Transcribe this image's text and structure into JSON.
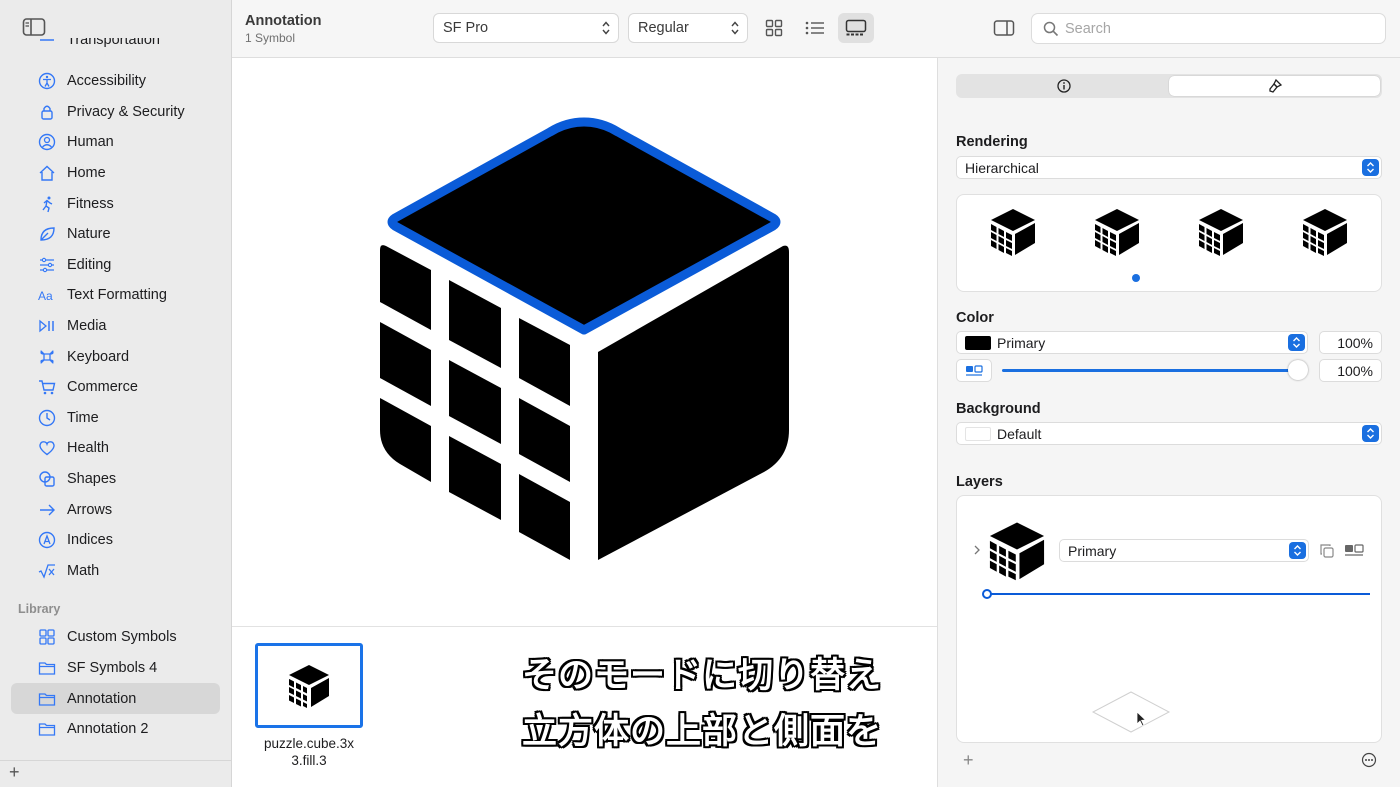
{
  "toolbar": {
    "title": "Annotation",
    "subtitle": "1 Symbol",
    "font_family_value": "SF Pro",
    "weight_value": "Regular",
    "search_placeholder": "Search"
  },
  "sidebar": {
    "partial_item": "Transportation",
    "categories": [
      {
        "label": "Accessibility",
        "icon": "accessibility-icon"
      },
      {
        "label": "Privacy & Security",
        "icon": "lock-icon"
      },
      {
        "label": "Human",
        "icon": "person-circle-icon"
      },
      {
        "label": "Home",
        "icon": "house-icon"
      },
      {
        "label": "Fitness",
        "icon": "figure-run-icon"
      },
      {
        "label": "Nature",
        "icon": "leaf-icon"
      },
      {
        "label": "Editing",
        "icon": "sliders-icon"
      },
      {
        "label": "Text Formatting",
        "icon": "textformat-icon"
      },
      {
        "label": "Media",
        "icon": "play-pause-icon"
      },
      {
        "label": "Keyboard",
        "icon": "command-icon"
      },
      {
        "label": "Commerce",
        "icon": "cart-icon"
      },
      {
        "label": "Time",
        "icon": "clock-icon"
      },
      {
        "label": "Health",
        "icon": "heart-icon"
      },
      {
        "label": "Shapes",
        "icon": "shapes-icon"
      },
      {
        "label": "Arrows",
        "icon": "arrow-right-icon"
      },
      {
        "label": "Indices",
        "icon": "a-circle-icon"
      },
      {
        "label": "Math",
        "icon": "sqrt-icon"
      }
    ],
    "library_header": "Library",
    "library": [
      {
        "label": "Custom Symbols",
        "icon": "grid-icon",
        "selected": false
      },
      {
        "label": "SF Symbols 4",
        "icon": "folder-icon",
        "selected": false
      },
      {
        "label": "Annotation",
        "icon": "folder-icon",
        "selected": true
      },
      {
        "label": "Annotation 2",
        "icon": "folder-icon",
        "selected": false
      }
    ]
  },
  "gallery": {
    "symbol_name_line1": "puzzle.cube.3x",
    "symbol_name_line2": "3.fill.3"
  },
  "captions": {
    "line1": "そのモードに切り替え",
    "line2": "立方体の上部と側面を"
  },
  "inspector": {
    "rendering_label": "Rendering",
    "rendering_value": "Hierarchical",
    "selected_mode_index": 1,
    "color_label": "Color",
    "color_value": "Primary",
    "color_opacity": "100%",
    "slider_value": "100%",
    "background_label": "Background",
    "background_value": "Default",
    "layers_label": "Layers",
    "layer_color_value": "Primary"
  },
  "colors": {
    "accent": "#1a6fe0",
    "highlight_outline": "#0a5bd8",
    "symbol": "#000000"
  }
}
